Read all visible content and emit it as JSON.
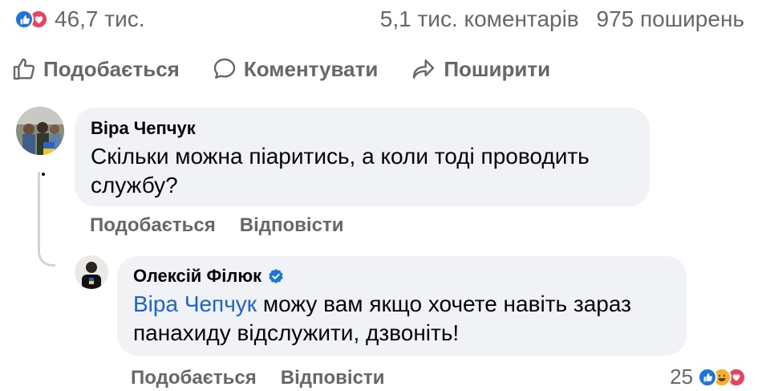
{
  "stats": {
    "reactions_count": "46,7 тис.",
    "comments_count": "5,1 тис. коментарів",
    "shares_count": "975 поширень"
  },
  "actions": {
    "like_label": "Подобається",
    "comment_label": "Коментувати",
    "share_label": "Поширити"
  },
  "comment": {
    "author": "Віра Чепчук",
    "text": "Скільки можна піаритись, а коли тоді проводить службу?",
    "like_label": "Подобається",
    "reply_label": "Відповісти"
  },
  "reply": {
    "author": "Олексій Філюк",
    "verified": true,
    "mention": "Віра Чепчук",
    "text": " можу вам якщо хочете навіть зараз панахиду відслужити, дзвоніть!",
    "like_label": "Подобається",
    "reply_label": "Відповісти",
    "reactions_count": "25"
  },
  "colors": {
    "like_blue": "#1b74e4",
    "love_red": "#f33e58",
    "haha_yellow": "#f7b125",
    "mention_blue": "#1c64d6",
    "secondary_text": "#65676b",
    "bubble_bg": "#f0f2f5"
  }
}
